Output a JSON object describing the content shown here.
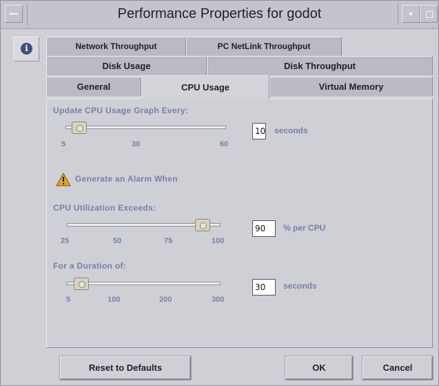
{
  "window": {
    "title": "Performance Properties for godot"
  },
  "tabs": {
    "row1": [
      "Network Throughput",
      "PC NetLink Throughput"
    ],
    "row2": [
      "Disk Usage",
      "Disk Throughput"
    ],
    "row3": [
      "General",
      "CPU Usage",
      "Virtual Memory"
    ],
    "active": "CPU Usage"
  },
  "update": {
    "label": "Update CPU Usage Graph Every:",
    "ticks": [
      "5",
      "30",
      "60"
    ],
    "value": "10",
    "unit": "seconds"
  },
  "alarm": {
    "label": "Generate an Alarm When"
  },
  "cpu": {
    "label": "CPU Utilization Exceeds:",
    "ticks": [
      "25",
      "50",
      "75",
      "100"
    ],
    "value": "90",
    "unit": "% per CPU"
  },
  "duration": {
    "label": "For a Duration of:",
    "ticks": [
      "5",
      "100",
      "200",
      "300"
    ],
    "value": "30",
    "unit": "seconds"
  },
  "buttons": {
    "reset": "Reset to Defaults",
    "ok": "OK",
    "cancel": "Cancel"
  },
  "icons": {
    "window_menu": "window-menu-icon",
    "info": "info-icon",
    "warning": "warning-icon"
  },
  "colors": {
    "label": "#7a7da8",
    "info_icon": "#3d4f7a",
    "warning_icon": "#e8a21a"
  }
}
